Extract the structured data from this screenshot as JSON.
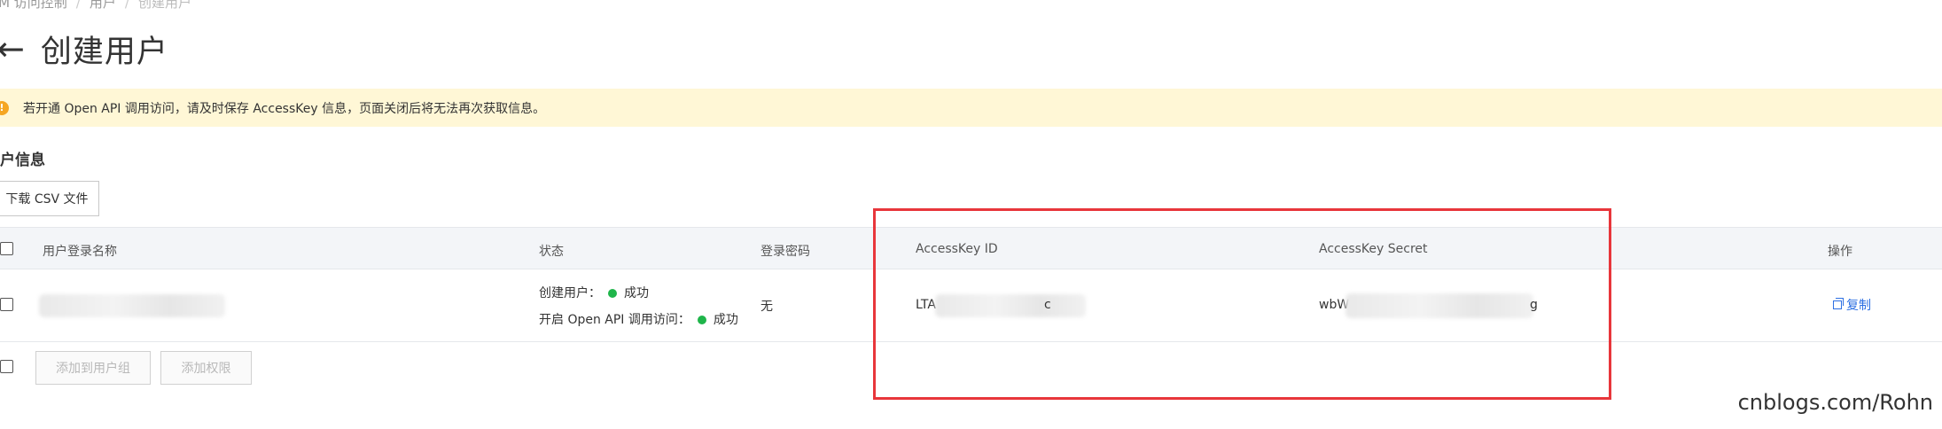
{
  "breadcrumb": {
    "item1": "RAM 访问控制",
    "item2": "用户",
    "item3": "创建用户"
  },
  "page": {
    "title": "创建用户",
    "back_icon": "←"
  },
  "alert": {
    "text": "若开通 Open API 调用访问，请及时保存 AccessKey 信息，页面关闭后将无法再次获取信息。"
  },
  "section": {
    "title": "户信息",
    "download_csv": "下载 CSV 文件"
  },
  "table": {
    "headers": {
      "login_name": "用户登录名称",
      "status": "状态",
      "password": "登录密码",
      "ak_id": "AccessKey ID",
      "ak_secret": "AccessKey Secret",
      "actions": "操作"
    },
    "rows": [
      {
        "status_create_label": "创建用户：",
        "status_create_value": "成功",
        "status_api_label": "开启 Open API 调用访问：",
        "status_api_value": "成功",
        "password": "无",
        "ak_id_prefix": "LTA",
        "ak_id_suffix": "c",
        "ak_secret_prefix": "wbW",
        "ak_secret_suffix": "g",
        "copy_label": "复制"
      }
    ]
  },
  "footer_actions": {
    "add_to_group": "添加到用户组",
    "add_permission": "添加权限"
  },
  "watermark": "cnblogs.com/Rohn",
  "colors": {
    "alert_bg": "#fff7d6",
    "success": "#1fb54a",
    "link": "#2d6fe2",
    "highlight": "#e8363b"
  }
}
